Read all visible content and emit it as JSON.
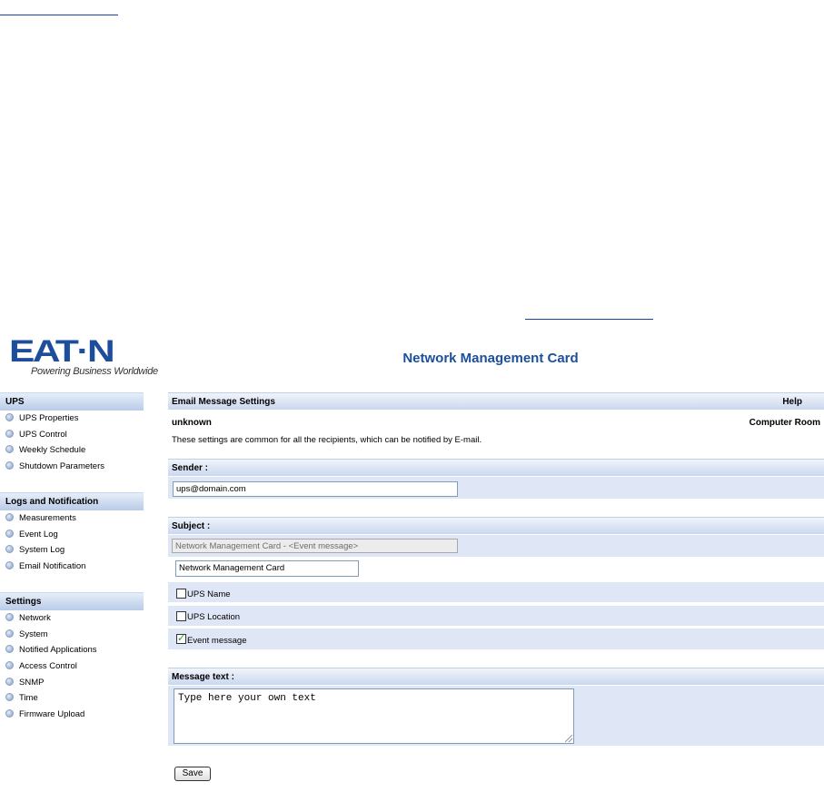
{
  "header": {
    "logo_text": "EAT·N",
    "logo_tagline": "Powering Business Worldwide",
    "title": "Network Management Card"
  },
  "sidebar": {
    "sections": [
      {
        "title": "UPS",
        "items": [
          "UPS Properties",
          "UPS Control",
          "Weekly Schedule",
          "Shutdown Parameters"
        ]
      },
      {
        "title": "Logs and Notification",
        "items": [
          "Measurements",
          "Event Log",
          "System Log",
          "Email Notification"
        ]
      },
      {
        "title": "Settings",
        "items": [
          "Network",
          "System",
          "Notified Applications",
          "Access Control",
          "SNMP",
          "Time",
          "Firmware Upload"
        ]
      }
    ]
  },
  "main": {
    "panel_title": "Email Message Settings",
    "help_label": "Help",
    "ups_name": "unknown",
    "location": "Computer Room",
    "description": "These settings are common for all the recipients, which can be notified by E-mail.",
    "sender": {
      "label": "Sender :",
      "value": "ups@domain.com"
    },
    "subject": {
      "label": "Subject :",
      "preview": "Network Management Card - <Event message>",
      "value": "Network Management Card",
      "options": [
        {
          "label": "UPS Name",
          "checked": false
        },
        {
          "label": "UPS Location",
          "checked": false
        },
        {
          "label": "Event message",
          "checked": true
        }
      ]
    },
    "message": {
      "label": "Message text :",
      "value": "Type here your own text"
    },
    "save_label": "Save"
  },
  "colors": {
    "brand": "#1d4e9b",
    "title": "#1b4f9c",
    "row_bg": "#dfe6f6",
    "link": "#1c3fa8"
  }
}
